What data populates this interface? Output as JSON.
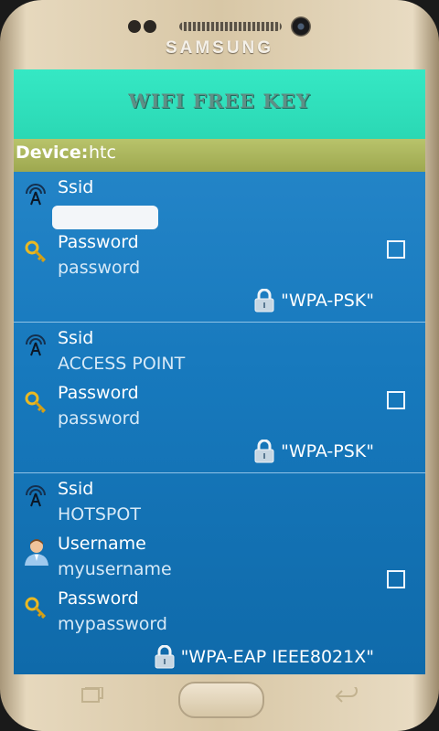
{
  "device_frame": {
    "brand": "SAMSUNG"
  },
  "app": {
    "title": "WIFI FREE KEY",
    "device_label": "Device:",
    "device_value": "htc"
  },
  "networks": [
    {
      "ssid_label": "Ssid",
      "ssid": "",
      "password_label": "Password",
      "password": "password",
      "security": "\"WPA-PSK\""
    },
    {
      "ssid_label": "Ssid",
      "ssid": "ACCESS POINT",
      "password_label": "Password",
      "password": "password",
      "security": "\"WPA-PSK\""
    },
    {
      "ssid_label": "Ssid",
      "ssid": "HOTSPOT",
      "username_label": "Username",
      "username": "myusername",
      "password_label": "Password",
      "password": "mypassword",
      "security": "\"WPA-EAP IEEE8021X\""
    }
  ],
  "colors": {
    "header": "#2bd8b4",
    "device_bar": "#a8b25a",
    "list_bg": "#1779bd"
  }
}
